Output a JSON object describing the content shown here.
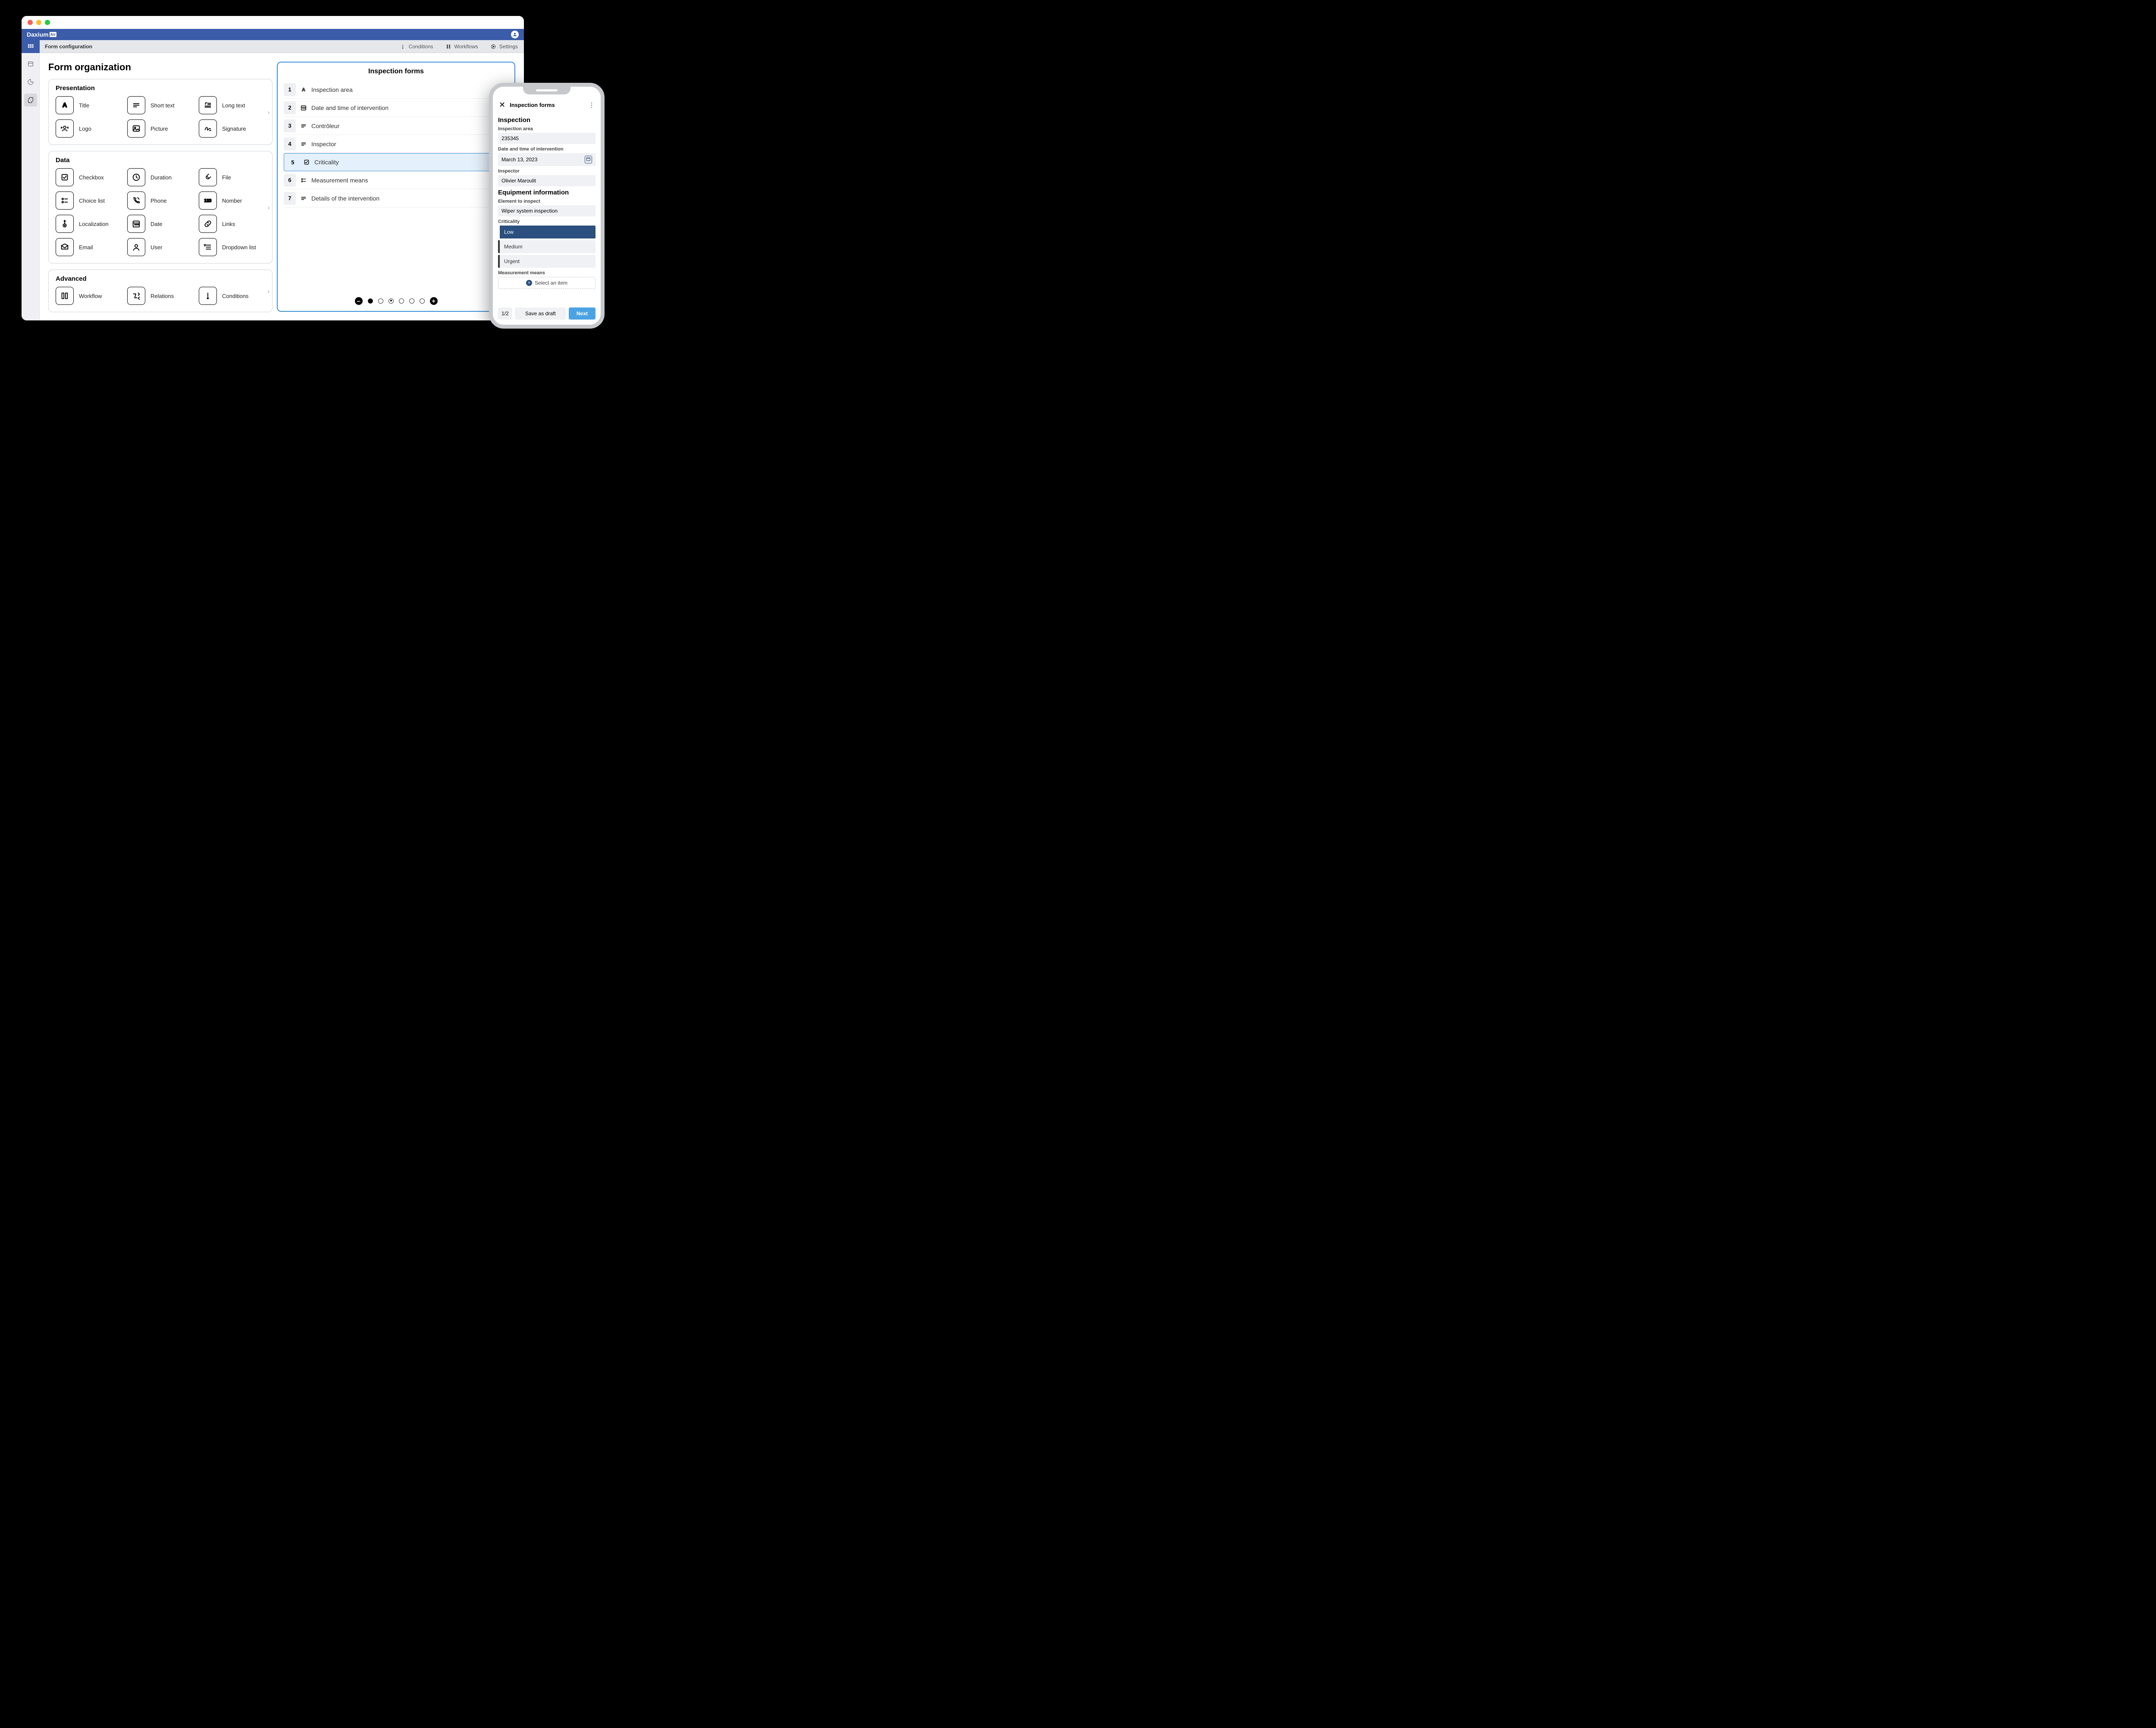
{
  "window": {
    "brand": "Daxium",
    "breadcrumb": "Form configuration",
    "topnav": [
      {
        "label": "Conditions",
        "icon": "exclaim"
      },
      {
        "label": "Workflows",
        "icon": "flow"
      },
      {
        "label": "Settings",
        "icon": "gear"
      }
    ]
  },
  "builder": {
    "title": "Form organization",
    "sections": [
      {
        "title": "Presentation",
        "tiles": [
          {
            "label": "Title",
            "icon": "title"
          },
          {
            "label": "Short text",
            "icon": "short-text"
          },
          {
            "label": "Long text",
            "icon": "long-text"
          },
          {
            "label": "Logo",
            "icon": "logo"
          },
          {
            "label": "Picture",
            "icon": "picture"
          },
          {
            "label": "Signature",
            "icon": "signature"
          }
        ]
      },
      {
        "title": "Data",
        "tiles": [
          {
            "label": "Checkbox",
            "icon": "checkbox"
          },
          {
            "label": "Duration",
            "icon": "duration"
          },
          {
            "label": "File",
            "icon": "file"
          },
          {
            "label": "Choice list",
            "icon": "choice-list"
          },
          {
            "label": "Phone",
            "icon": "phone"
          },
          {
            "label": "Nomber",
            "icon": "number"
          },
          {
            "label": "Localization",
            "icon": "localization"
          },
          {
            "label": "Date",
            "icon": "date"
          },
          {
            "label": "Links",
            "icon": "links"
          },
          {
            "label": "Email",
            "icon": "email"
          },
          {
            "label": "User",
            "icon": "user"
          },
          {
            "label": "Dropdown list",
            "icon": "dropdown"
          }
        ]
      },
      {
        "title": "Advanced",
        "tiles": [
          {
            "label": "Workflow",
            "icon": "workflow"
          },
          {
            "label": "Relations",
            "icon": "relations"
          },
          {
            "label": "Conditions",
            "icon": "conditions"
          }
        ]
      }
    ]
  },
  "form_preview": {
    "title": "Inspection forms",
    "rows": [
      {
        "num": "1",
        "icon": "title",
        "label": "Inspection area"
      },
      {
        "num": "2",
        "icon": "date",
        "label": "Date and time of intervention"
      },
      {
        "num": "3",
        "icon": "short-text",
        "label": "Contrôleur"
      },
      {
        "num": "4",
        "icon": "short-text",
        "label": "Inspector"
      },
      {
        "num": "5",
        "icon": "checkbox",
        "label": "Criticality",
        "selected": true
      },
      {
        "num": "6",
        "icon": "choice-list",
        "label": "Measurement means"
      },
      {
        "num": "7",
        "icon": "short-text",
        "label": "Details of the intervention"
      }
    ],
    "pager": {
      "minus": "–",
      "plus": "+"
    }
  },
  "phone": {
    "header_title": "Inspection forms",
    "section1_title": "Inspection",
    "fields": {
      "area_label": "Inspection area",
      "area_value": "235345",
      "date_label": "Date and time of intervention",
      "date_value": "March 13, 2023",
      "inspector_label": "Inspector",
      "inspector_value": "Olivier Maroulit"
    },
    "section2_title": "Equipment information",
    "element_label": "Element to inspect",
    "element_value": "Wiper system inspection",
    "criticality_label": "Criticality",
    "criticality_options": [
      "Low",
      "Medium",
      "Urgent"
    ],
    "measurement_label": "Measurement means",
    "select_item_label": "Select an item",
    "footer": {
      "page": "1/2",
      "draft": "Save as draft",
      "next": "Next"
    }
  }
}
